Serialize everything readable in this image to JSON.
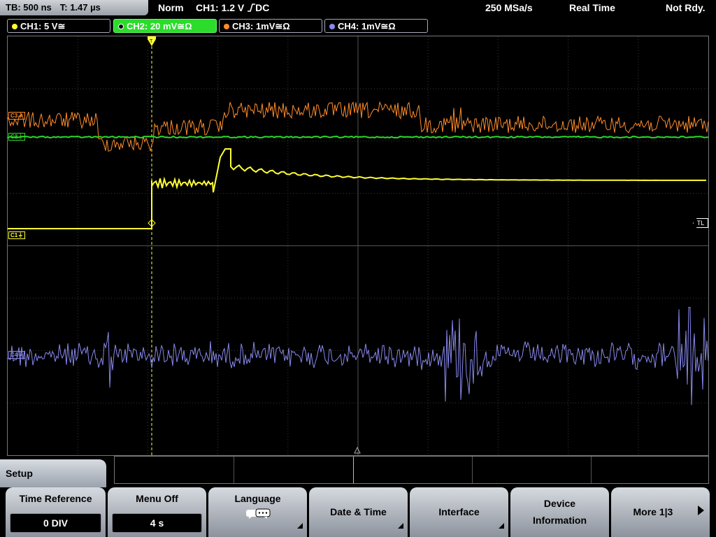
{
  "topbar": {
    "timebase": "TB: 500 ns",
    "trigger_time": "T: 1.47 µs",
    "mode": "Norm",
    "trigger_source": "CH1: 1.2 V",
    "trigger_slope": "⌐",
    "trigger_coupling": "DC",
    "sample_rate": "250 MSa/s",
    "acq_mode": "Real Time",
    "status": "Not Rdy."
  },
  "channels": [
    {
      "label": "CH1: 5 V≅",
      "color": "#ffff33",
      "active": false
    },
    {
      "label": "CH2: 20 mV≅Ω",
      "color": "#2bdc2b",
      "active": true
    },
    {
      "label": "CH3: 1mV≅Ω",
      "color": "#ff8c2a",
      "active": false
    },
    {
      "label": "CH4: 1mV≅Ω",
      "color": "#8888ee",
      "active": false
    }
  ],
  "markers": {
    "c3": "C3",
    "c2": "C2",
    "c1": "C1",
    "c4": "C4",
    "trigger_level": "TL",
    "trigger_pos": "T"
  },
  "bottom": {
    "menu_title": "Setup",
    "softkeys": [
      {
        "label": "Time Reference",
        "value": "0 DIV"
      },
      {
        "label": "Menu Off",
        "value": "4 s"
      },
      {
        "label": "Language",
        "icon": "speech-bubbles-icon"
      },
      {
        "label": "Date & Time"
      },
      {
        "label": "Interface"
      },
      {
        "label": "Device",
        "label2": "Information"
      },
      {
        "label": "More 1|3"
      }
    ]
  },
  "colors": {
    "ch1": "#ffff33",
    "ch2": "#2bdc2b",
    "ch3": "#ff8c2a",
    "ch4": "#8888ee",
    "grid": "#3a3a3a"
  }
}
